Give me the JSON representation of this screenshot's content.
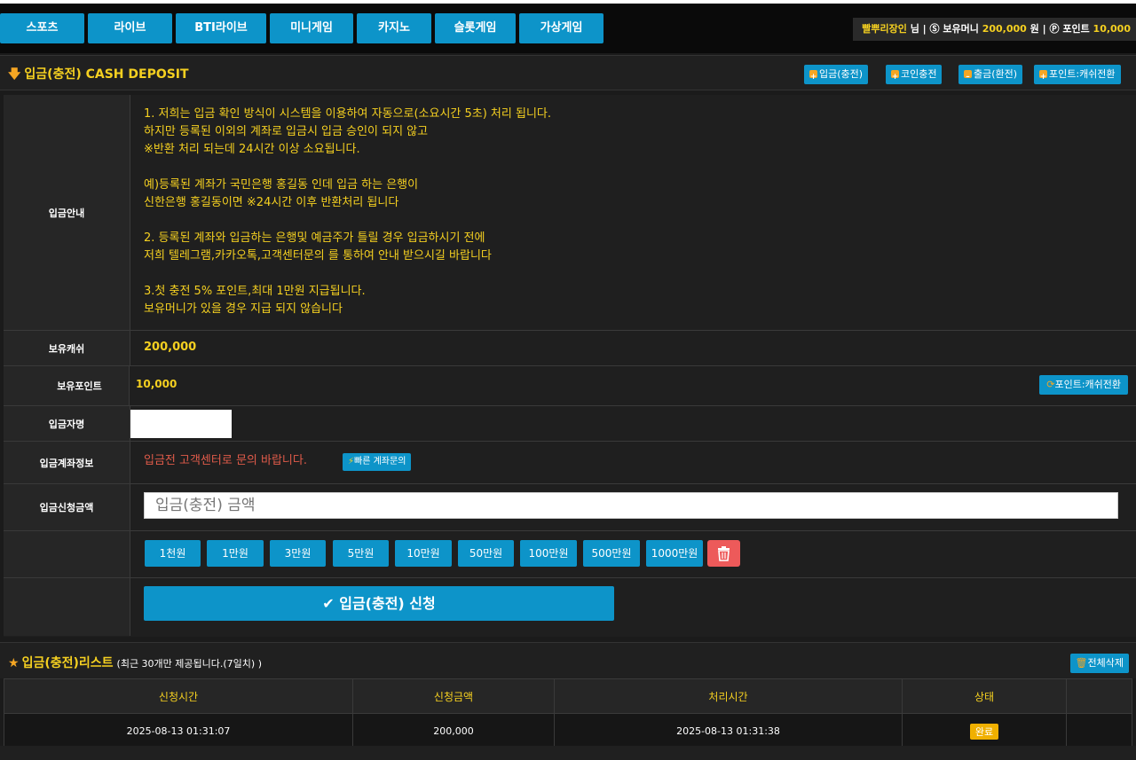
{
  "nav": {
    "items": [
      "스포츠",
      "라이브",
      "BTI라이브",
      "미니게임",
      "카지노",
      "슬롯게임",
      "가상게임"
    ]
  },
  "user": {
    "name": "빨뿌리장인",
    "honorific": "님 |",
    "money_label": "보유머니",
    "money_value": "200,000",
    "money_unit": "원 |",
    "point_label": "포인트",
    "point_value": "10,000"
  },
  "page": {
    "title": "입금(충전) CASH DEPOSIT",
    "actions": [
      "입금(충전)",
      "코인충전",
      "출금(환전)",
      "포인트:캐쉬전환"
    ]
  },
  "form": {
    "guide_label": "입금안내",
    "guide_lines": [
      "1. 저희는 입금 확인 방식이 시스템을 이용하여 자동으로(소요시간 5초) 처리 됩니다.",
      "하지만 등록된 이외의 계좌로 입금시 입금 승인이 되지 않고",
      "※반환 처리 되는데 24시간 이상 소요됩니다.",
      "",
      "예)등록된 계좌가 국민은행 홍길동 인데 입금 하는 은행이",
      "신한은행 홍길동이면 ※24시간 이후 반환처리 됩니다",
      "",
      "2. 등록된 계좌와 입금하는 은행및 예금주가 틀릴 경우 입금하시기 전에",
      "저희 텔레그램,카카오톡,고객센터문의 를 통하여 안내 받으시길 바랍니다",
      "",
      "3.첫 충전 5% 포인트,최대 1만원 지급됩니다.",
      "보유머니가 있을 경우 지급 되지 않습니다"
    ],
    "cash_label": "보유캐쉬",
    "cash_value": "200,000",
    "point_label": "보유포인트",
    "point_value": "10,000",
    "convert_button": "포인트:캐쉬전환",
    "depositor_label": "입금자명",
    "depositor_value": "",
    "account_label": "입금계좌정보",
    "account_text": "입금전 고객센터로 문의 바랍니다.",
    "account_button": "빠른 계좌문의",
    "amount_label": "입금신청금액",
    "amount_placeholder": "입금(충전) 금액",
    "quick_amounts": [
      "1천원",
      "1만원",
      "3만원",
      "5만원",
      "10만원",
      "50만원",
      "100만원",
      "500만원",
      "1000만원"
    ],
    "submit_label": "입금(충전) 신청"
  },
  "list": {
    "title": "입금(충전)리스트",
    "subtitle": "(최근 30개만 제공됩니다.(7일치) )",
    "delete_all": "전체삭제",
    "columns": [
      "신청시간",
      "신청금액",
      "처리시간",
      "상태",
      ""
    ],
    "rows": [
      {
        "requested": "2025-08-13 01:31:07",
        "amount": "200,000",
        "processed": "2025-08-13 01:31:38",
        "status": "완료"
      }
    ]
  },
  "colors": {
    "accent": "#0d94c9",
    "highlight": "#f5d020",
    "danger": "#ed5a5a",
    "warning": "#f0b000"
  }
}
